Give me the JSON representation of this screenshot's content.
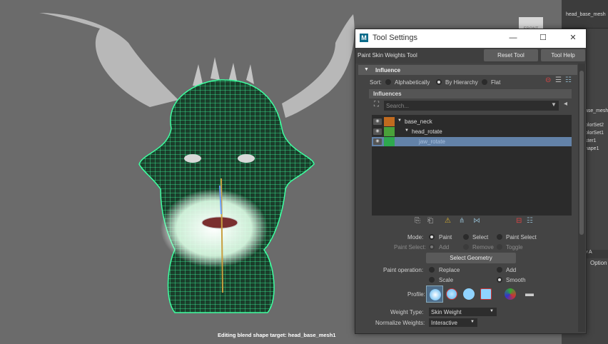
{
  "viewport": {
    "status_text": "Editing blend shape target: head_base_mesh1",
    "view_cube_label": "FRONT"
  },
  "right_panel": {
    "header": "head_base_mesh",
    "items": [
      "ase_mesh",
      "olorSet2",
      "olorSet1",
      "ster1",
      "hape1"
    ],
    "tabs": "y  A",
    "option_label": "Option"
  },
  "window": {
    "title": "Tool Settings",
    "minimize": "—",
    "maximize": "☐",
    "close": "✕",
    "tool_name": "Paint Skin Weights Tool",
    "reset_label": "Reset Tool",
    "help_label": "Tool Help"
  },
  "influence": {
    "section_title": "Influence",
    "sort_label": "Sort:",
    "sort_options": [
      "Alphabetically",
      "By Hierarchy",
      "Flat"
    ],
    "sort_selected": "By Hierarchy",
    "influences_header": "Influences",
    "search_placeholder": "Search...",
    "items": [
      {
        "name": "base_neck",
        "color": "#c06a1f",
        "depth": 0
      },
      {
        "name": "head_rotate",
        "color": "#4aa13a",
        "depth": 1
      },
      {
        "name": "jaw_rotate",
        "color": "#2ea84e",
        "depth": 2,
        "selected": true
      }
    ]
  },
  "mode": {
    "label": "Mode:",
    "options": [
      "Paint",
      "Select",
      "Paint Select"
    ],
    "selected": "Paint"
  },
  "paint_select": {
    "label": "Paint Select:",
    "options": [
      "Add",
      "Remove",
      "Toggle"
    ],
    "selected": "Add"
  },
  "select_geometry_label": "Select Geometry",
  "paint_operation": {
    "label": "Paint operation:",
    "options": [
      "Replace",
      "Add",
      "Scale",
      "Smooth"
    ],
    "selected": "Smooth"
  },
  "profile_label": "Profile:",
  "weight_type": {
    "label": "Weight Type:",
    "value": "Skin Weight"
  },
  "normalize_weights": {
    "label": "Normalize Weights:",
    "value": "Interactive"
  },
  "colors": {
    "wireframe": "#3dffa0",
    "selected_row": "#6382a8",
    "panel": "#444444"
  }
}
